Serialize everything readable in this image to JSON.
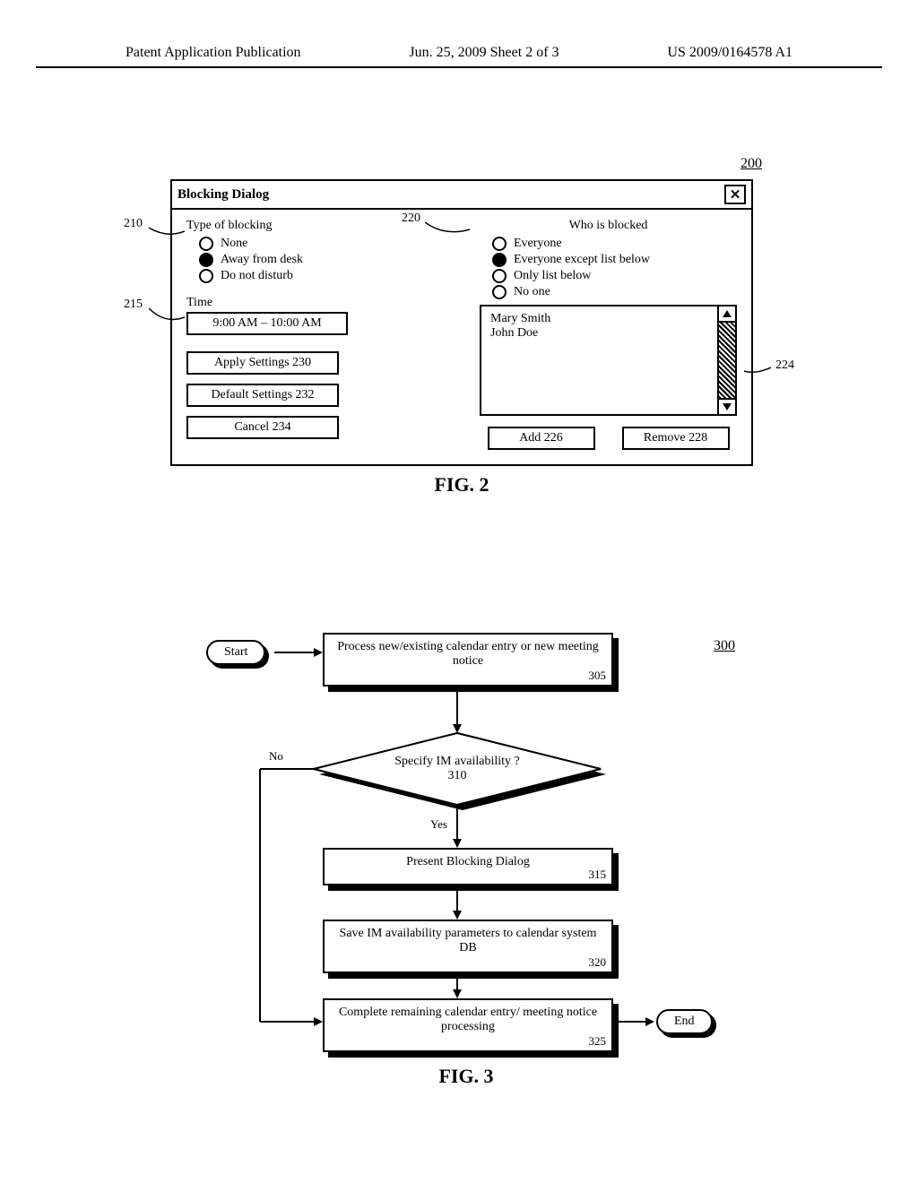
{
  "header": {
    "left": "Patent Application Publication",
    "mid": "Jun. 25, 2009  Sheet 2 of 3",
    "right": "US 2009/0164578 A1"
  },
  "fig2": {
    "ref200": "200",
    "title": "Blocking Dialog",
    "callout210": "210",
    "callout215": "215",
    "callout220": "220",
    "callout224": "224",
    "type_label": "Type of blocking",
    "type_options": {
      "none": "None",
      "away": "Away from desk",
      "dnd": "Do not disturb"
    },
    "time_label": "Time",
    "time_value": "9:00 AM – 10:00 AM",
    "apply_btn": "Apply Settings 230",
    "default_btn": "Default Settings 232",
    "cancel_btn": "Cancel 234",
    "who_label": "Who is blocked",
    "who_options": {
      "everyone": "Everyone",
      "except": "Everyone except list below",
      "only": "Only list below",
      "noone": "No one"
    },
    "list": {
      "p1": "Mary Smith",
      "p2": "John Doe"
    },
    "add_btn": "Add 226",
    "remove_btn": "Remove 228",
    "caption": "FIG. 2"
  },
  "fig3": {
    "ref300": "300",
    "start": "Start",
    "end": "End",
    "b305": "Process new/existing calendar entry or new meeting notice",
    "n305": "305",
    "d310": "Specify IM availability ?",
    "n310": "310",
    "yes": "Yes",
    "no": "No",
    "b315": "Present Blocking Dialog",
    "n315": "315",
    "b320": "Save IM availability parameters to calendar system DB",
    "n320": "320",
    "b325": "Complete remaining calendar entry/ meeting notice processing",
    "n325": "325",
    "caption": "FIG. 3"
  }
}
